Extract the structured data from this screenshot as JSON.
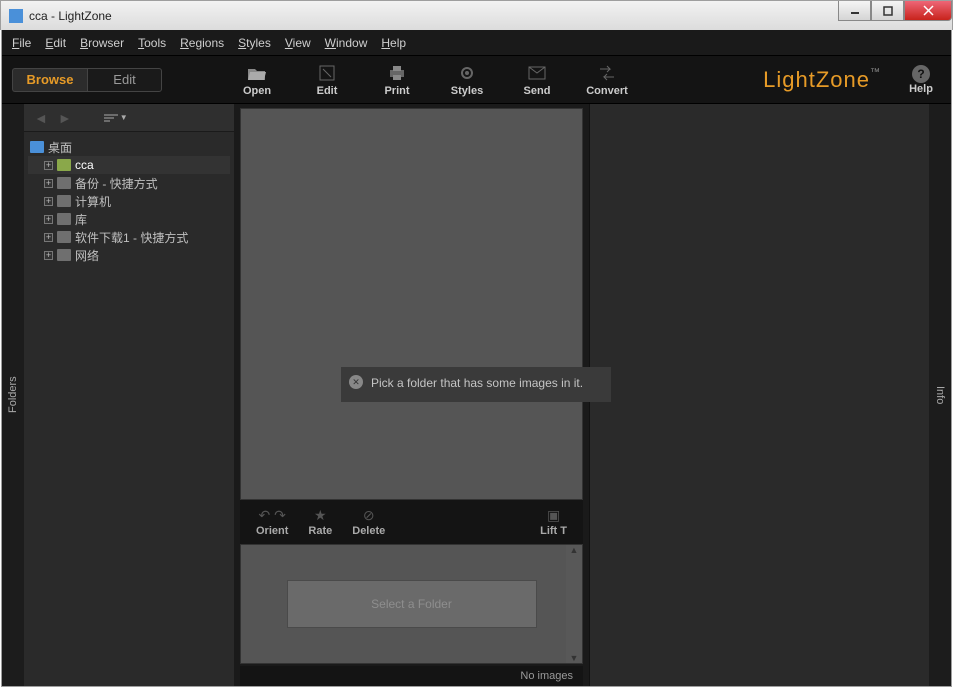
{
  "window": {
    "title": "cca - LightZone"
  },
  "menubar": {
    "file": "File",
    "edit": "Edit",
    "browser": "Browser",
    "tools": "Tools",
    "regions": "Regions",
    "styles": "Styles",
    "view": "View",
    "window": "Window",
    "help": "Help"
  },
  "mode": {
    "browse": "Browse",
    "edit": "Edit"
  },
  "toolbar": {
    "open": "Open",
    "edit": "Edit",
    "print": "Print",
    "styles": "Styles",
    "send": "Send",
    "convert": "Convert",
    "help": "Help"
  },
  "logo": {
    "text": "LightZone",
    "tm": "™"
  },
  "side_tabs": {
    "folders": "Folders",
    "info": "Info"
  },
  "tree": {
    "root": "桌面",
    "items": [
      {
        "label": "cca"
      },
      {
        "label": "备份 - 快捷方式"
      },
      {
        "label": "计算机"
      },
      {
        "label": "库"
      },
      {
        "label": "软件下载1 - 快捷方式"
      },
      {
        "label": "网络"
      }
    ]
  },
  "tooltip": {
    "text": "Pick a folder that has some images in it."
  },
  "mid_toolbar": {
    "orient": "Orient",
    "rate": "Rate",
    "delete": "Delete",
    "lift": "Lift T"
  },
  "thumbs": {
    "select_folder": "Select a Folder"
  },
  "status": {
    "text": "No images"
  }
}
